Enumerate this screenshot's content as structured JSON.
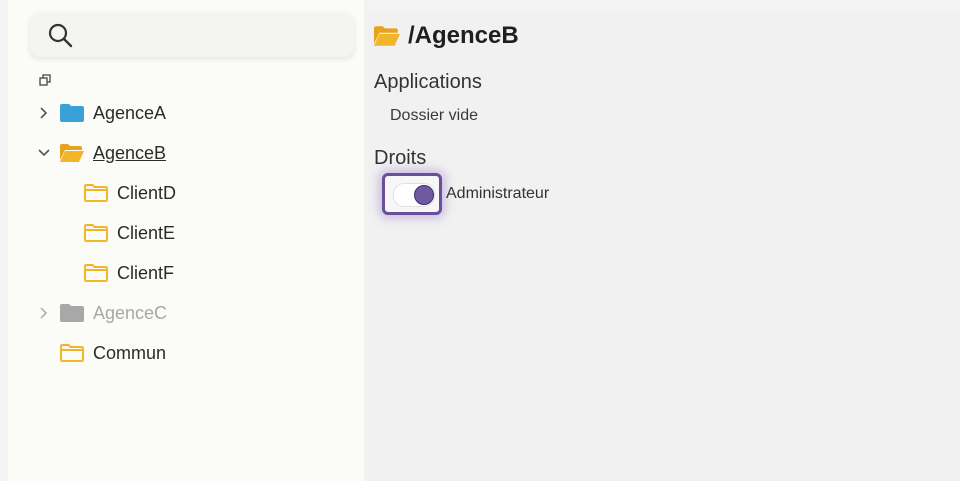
{
  "search": {
    "placeholder": ""
  },
  "tree": [
    {
      "label": "AgenceA",
      "state": "collapsed",
      "folder_color": "#3aa0d8"
    },
    {
      "label": "AgenceB",
      "state": "expanded",
      "folder_color": "#f2b52a",
      "selected": true
    },
    {
      "label": "ClientD",
      "folder_color": "#f2b52a"
    },
    {
      "label": "ClientE",
      "folder_color": "#f2b52a"
    },
    {
      "label": "ClientF",
      "folder_color": "#f2b52a"
    },
    {
      "label": "AgenceC",
      "state": "collapsed",
      "disabled": true,
      "folder_color": "#a8a8a8"
    },
    {
      "label": "Commun",
      "folder_color": "#f2b52a"
    }
  ],
  "main": {
    "path": "/AgenceB",
    "applications_title": "Applications",
    "applications_empty": "Dossier vide",
    "rights_title": "Droits",
    "admin_toggle_label": "Administrateur",
    "admin_toggle_on": true
  },
  "colors": {
    "accent": "#6f5aa0",
    "folder_yellow": "#f2b52a",
    "folder_blue": "#3aa0d8"
  }
}
